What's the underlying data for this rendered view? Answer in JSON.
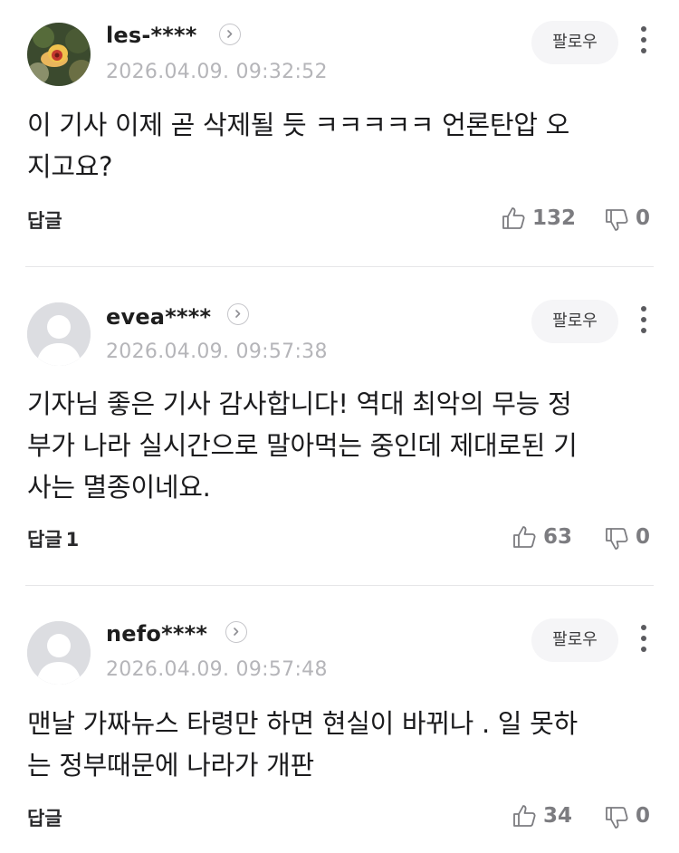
{
  "comments": [
    {
      "nickname": "les-****",
      "date": "2026.04.09. 09:32:52",
      "follow_label": "팔로우",
      "text_lines": [
        "이 기사 이제 곧 삭제될 듯 ㅋㅋㅋㅋㅋ 언론탄압 오",
        "지고요?"
      ],
      "reply_label": "답글",
      "reply_count": "",
      "likes": "132",
      "dislikes": "0",
      "avatar": "flower-photo-avatar"
    },
    {
      "nickname": "evea****",
      "date": "2026.04.09. 09:57:38",
      "follow_label": "팔로우",
      "text_lines": [
        "기자님 좋은 기사 감사합니다! 역대 최악의 무능 정",
        "부가 나라 실시간으로 말아먹는 중인데 제대로된 기",
        "사는 멸종이네요."
      ],
      "reply_label": "답글",
      "reply_count": "1",
      "likes": "63",
      "dislikes": "0",
      "avatar": "default-user-avatar"
    },
    {
      "nickname": "nefo****",
      "date": "2026.04.09. 09:57:48",
      "follow_label": "팔로우",
      "text_lines": [
        "맨날 가짜뉴스 타령만 하면 현실이 바뀌나 . 일 못하",
        "는 정부때문에 나라가 개판"
      ],
      "reply_label": "답글",
      "reply_count": "",
      "likes": "34",
      "dislikes": "0",
      "avatar": "default-user-avatar"
    }
  ],
  "icons": {
    "more": "more-vertical-icon",
    "chevron": "chevron-right-icon",
    "like": "thumbs-up-icon",
    "dislike": "thumbs-down-icon"
  },
  "colors": {
    "muted": "#b5b5b9",
    "count": "#7c7c80",
    "follow_bg": "#f5f5f7"
  }
}
